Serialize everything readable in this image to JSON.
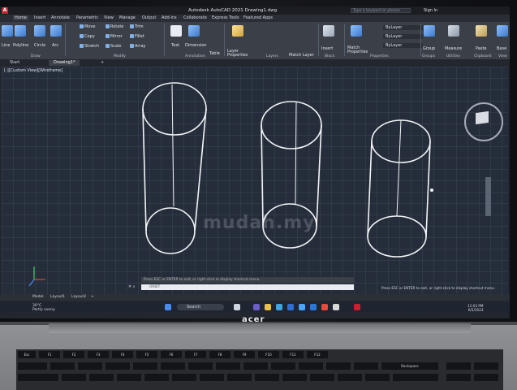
{
  "app": {
    "title": "Autodesk AutoCAD 2021   Drawing1.dwg",
    "search_placeholder": "Type a keyword or phrase",
    "sign_in": "Sign In",
    "logo": "A"
  },
  "ribbon_tabs": [
    "Home",
    "Insert",
    "Annotate",
    "Parametric",
    "View",
    "Manage",
    "Output",
    "Add-ins",
    "Collaborate",
    "Express Tools",
    "Featured Apps"
  ],
  "ribbon": {
    "draw": [
      "Line",
      "Polyline",
      "Circle",
      "Arc"
    ],
    "modify": [
      "Move",
      "Rotate",
      "Trim",
      "Copy",
      "Mirror",
      "Fillet",
      "Stretch",
      "Scale",
      "Array"
    ],
    "annotation": [
      "Text",
      "Dimension",
      "Table"
    ],
    "layers": [
      "Layer Properties",
      "Match Layer"
    ],
    "block": [
      "Insert"
    ],
    "properties": [
      "Match Properties",
      "ByLayer",
      "ByLayer",
      "ByLayer"
    ],
    "groups": [
      "Group"
    ],
    "utilities": [
      "Measure"
    ],
    "clipboard": [
      "Paste"
    ],
    "view": [
      "Base"
    ],
    "panels": [
      "Draw",
      "Modify",
      "Annotation",
      "Layers",
      "Block",
      "Properties",
      "Groups",
      "Utilities",
      "Clipboard",
      "View"
    ]
  },
  "file_tabs": [
    "Start",
    "Drawing1*",
    "+"
  ],
  "viewport": {
    "label": "[-][Custom View][Wireframe]"
  },
  "command": {
    "hint": "Press ESC or ENTER to exit, or right-click to display shortcut menu.",
    "input_placeholder": "ORBIT",
    "status_message": "Press ESC or ENTER to exit, or right-click to display shortcut menu."
  },
  "layout_tabs": [
    "Model",
    "Layout1",
    "Layout2",
    "+"
  ],
  "taskbar": {
    "weather_temp": "30°C",
    "weather_desc": "Partly sunny",
    "search": "Search",
    "time": "12:03 PM",
    "date": "6/5/2023"
  },
  "laptop_brand": "acer",
  "watermark": "mudah.my",
  "keyboard": [
    "Esc",
    "F1",
    "F2",
    "F3",
    "F4",
    "F5",
    "F6",
    "F7",
    "F8",
    "F9",
    "F10",
    "F11",
    "F12",
    "Backspace"
  ],
  "colors": {
    "viewport_bg": "#252d3a",
    "ribbon_bg": "#3b3f47",
    "wireframe": "#f2f4f7",
    "autocad_red": "#c8232c"
  }
}
